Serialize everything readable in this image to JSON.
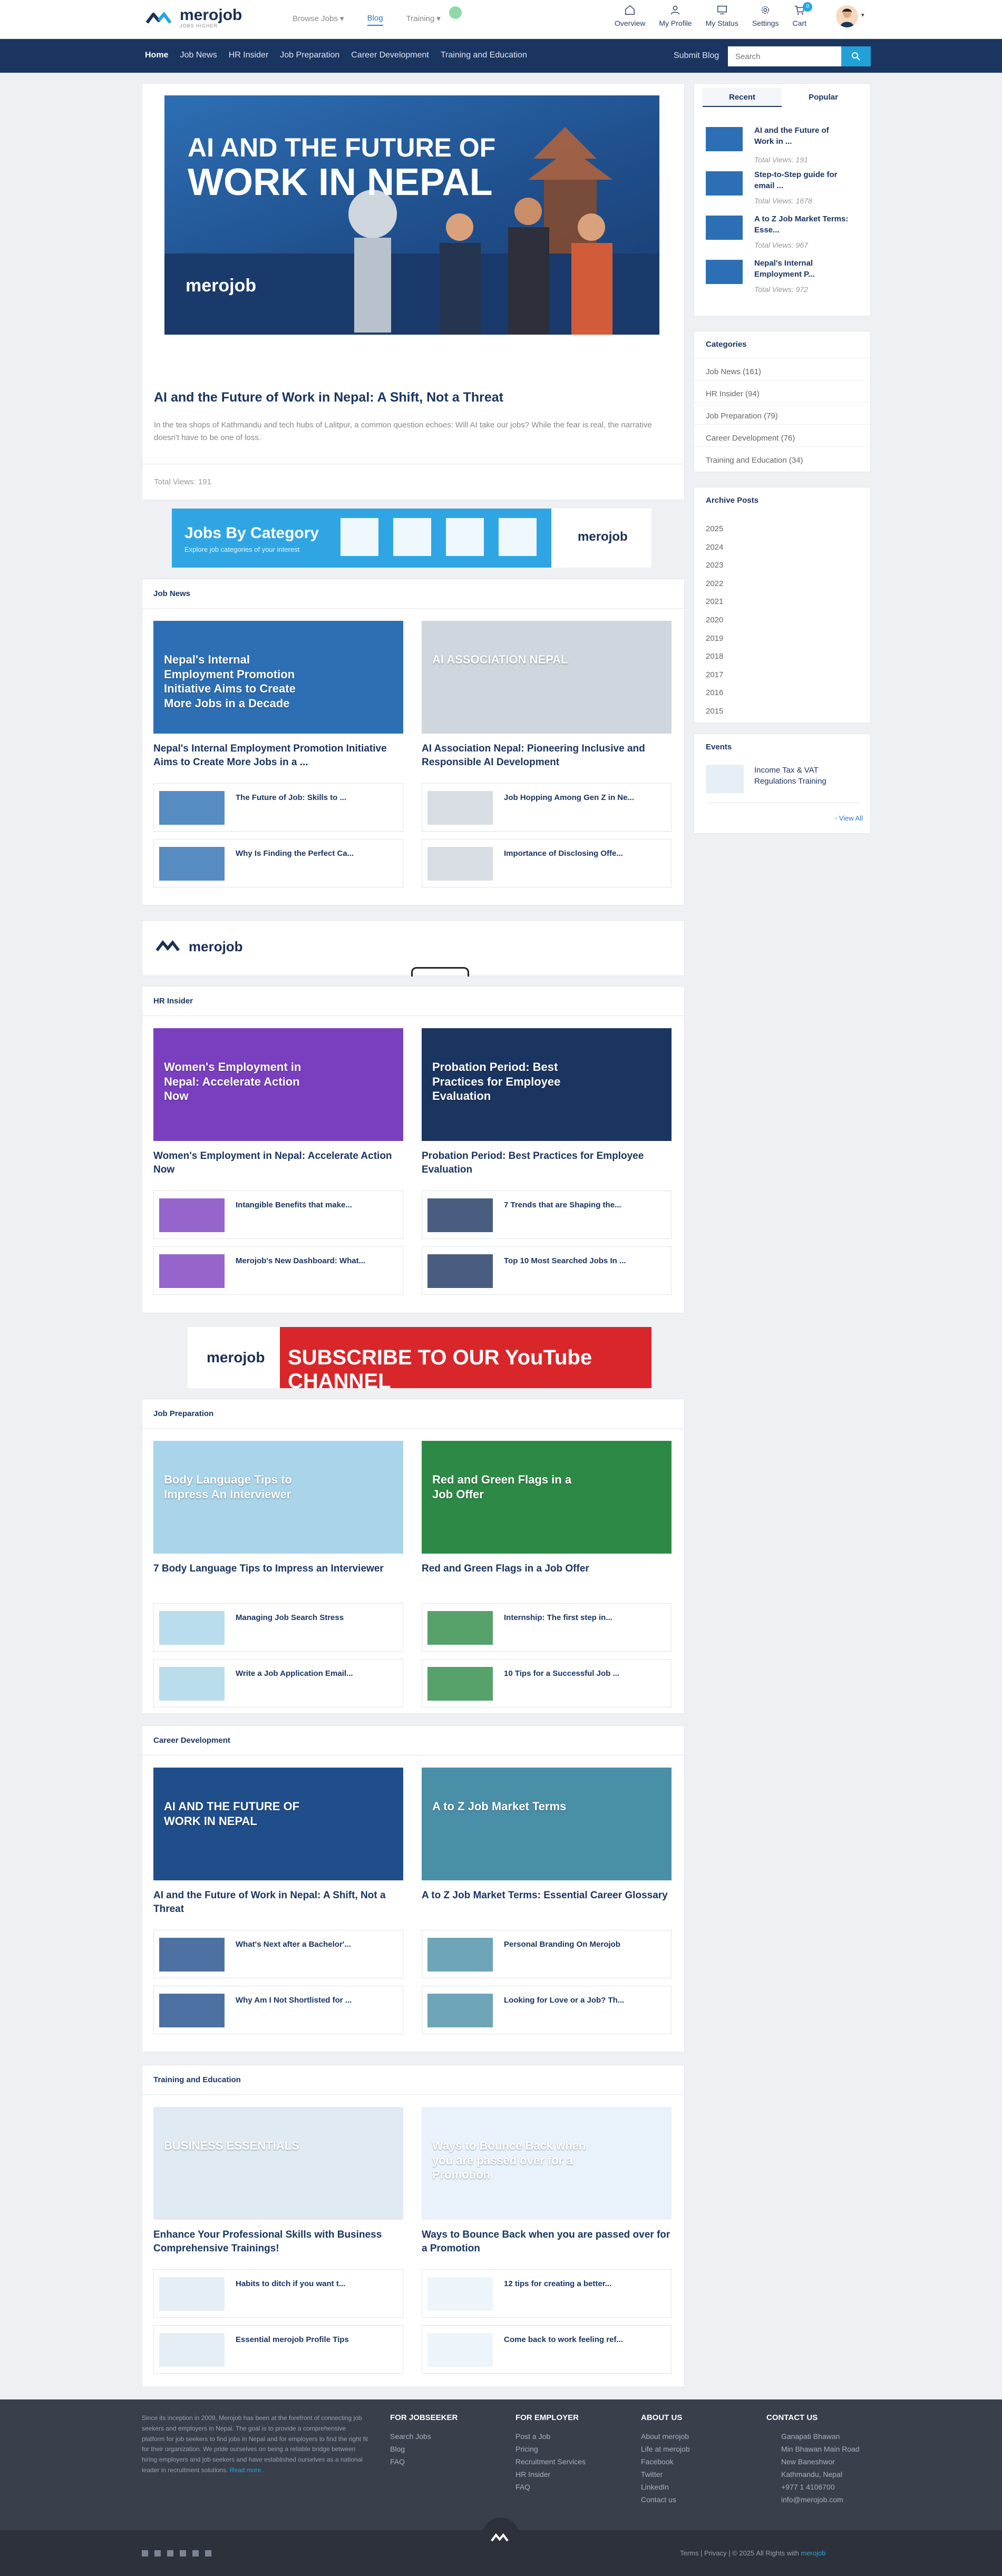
{
  "brand": {
    "name": "merojob",
    "tagline": "JOBS HIGHER"
  },
  "topnav": {
    "browse": "Browse Jobs",
    "blog": "Blog",
    "training": "Training"
  },
  "tools": [
    {
      "label": "Overview",
      "icon": "home-icon"
    },
    {
      "label": "My Profile",
      "icon": "user-icon"
    },
    {
      "label": "My Status",
      "icon": "monitor-icon"
    },
    {
      "label": "Settings",
      "icon": "gear-icon"
    },
    {
      "label": "Cart",
      "icon": "cart-icon",
      "badge": "0"
    }
  ],
  "navbar": {
    "links": [
      "Home",
      "Job News",
      "HR Insider",
      "Job Preparation",
      "Career Development",
      "Training and Education"
    ],
    "submit": "Submit Blog",
    "search_placeholder": "Search"
  },
  "hero": {
    "img_line1": "AI AND THE FUTURE OF",
    "img_line2": "WORK IN NEPAL",
    "img_brand": "merojob",
    "title": "AI and the Future of Work in Nepal: A Shift, Not a Threat",
    "desc": "In the tea shops of Kathmandu and tech hubs of Lalitpur, a common question echoes: Will AI take our jobs? While the fear is real, the narrative doesn't have to be one of loss.",
    "views": "Total Views: 191"
  },
  "banner": {
    "title": "Jobs By Category",
    "subtitle": "Explore job categories of your interest",
    "brand": "merojob"
  },
  "sections": [
    {
      "title": "Job News",
      "features": [
        {
          "title": "Nepal's Internal Employment Promotion Initiative Aims to Create More Jobs in a ...",
          "img": "Nepal's Internal Employment Promotion Initiative Aims to Create More Jobs in a Decade"
        },
        {
          "title": "AI Association Nepal: Pioneering Inclusive and Responsible AI Development",
          "img": "AI ASSOCIATION NEPAL"
        }
      ],
      "minis": [
        "The Future of Job: Skills to ...",
        "Job Hopping Among Gen Z in Ne...",
        "Why Is Finding the Perfect Ca...",
        "Importance of Disclosing Offe..."
      ]
    },
    {
      "title": "HR Insider",
      "features": [
        {
          "title": "Women's Employment in Nepal: Accelerate Action Now",
          "img": "Women's Employment in Nepal: Accelerate Action Now"
        },
        {
          "title": "Probation Period: Best Practices for Employee Evaluation",
          "img": "Probation Period: Best Practices for Employee Evaluation"
        }
      ],
      "minis": [
        "Intangible Benefits that make...",
        "7 Trends that are Shaping the...",
        "Merojob's New Dashboard: What...",
        "Top 10 Most Searched Jobs In ..."
      ]
    },
    {
      "title": "Job Preparation",
      "features": [
        {
          "title": "7 Body Language Tips to Impress an Interviewer",
          "img": "Body Language Tips to Impress An Interviewer"
        },
        {
          "title": "Red and Green Flags in a Job Offer",
          "img": "Red and Green Flags in a Job Offer"
        }
      ],
      "minis": [
        "Managing Job Search Stress",
        "Internship: The first step in...",
        "Write a Job Application Email...",
        "10 Tips for a Successful Job ..."
      ]
    },
    {
      "title": "Career Development",
      "features": [
        {
          "title": "AI and the Future of Work in Nepal: A Shift, Not a Threat",
          "img": "AI AND THE FUTURE OF WORK IN NEPAL"
        },
        {
          "title": "A to Z Job Market Terms: Essential Career Glossary",
          "img": "A to Z Job Market Terms"
        }
      ],
      "minis": [
        "What's Next after a Bachelor'...",
        "Personal Branding On Merojob",
        "Why Am I Not Shortlisted for ...",
        "Looking for Love or a Job? Th..."
      ]
    },
    {
      "title": "Training and Education",
      "features": [
        {
          "title": "Enhance Your Professional Skills with Business Comprehensive Trainings!",
          "img": "BUSINESS ESSENTIALS"
        },
        {
          "title": "Ways to Bounce Back when you are passed over for a Promotion",
          "img": "Ways to Bounce Back when you are passed over for a Promotion"
        }
      ],
      "minis": [
        "Habits to ditch if you want t...",
        "12 tips for creating a better...",
        "Essential merojob Profile Tips",
        "Come back to work feeling ref..."
      ]
    }
  ],
  "ads": {
    "mid_brand": "merojob",
    "yt": "SUBSCRIBE TO OUR YouTube CHANNEL"
  },
  "sidebar": {
    "tabs": [
      "Recent",
      "Popular"
    ],
    "recent": [
      {
        "title": "AI and the Future of Work in ...",
        "views": "Total Views: 191"
      },
      {
        "title": "Step-to-Step guide for email ...",
        "views": "Total Views: 1678"
      },
      {
        "title": "A to Z Job Market Terms: Esse...",
        "views": "Total Views: 967"
      },
      {
        "title": "Nepal's Internal Employment P...",
        "views": "Total Views: 972"
      }
    ],
    "categories_title": "Categories",
    "categories": [
      "Job News (161)",
      "HR Insider (94)",
      "Job Preparation (79)",
      "Career Development (76)",
      "Training and Education (34)"
    ],
    "archive_title": "Archive Posts",
    "archive": [
      "2025",
      "2024",
      "2023",
      "2022",
      "2021",
      "2020",
      "2019",
      "2018",
      "2017",
      "2016",
      "2015"
    ],
    "events_title": "Events",
    "event": "Income Tax & VAT Regulations Training",
    "view_all": "View All"
  },
  "footer": {
    "about": "Since its inception in 2009, Merojob has been at the forefront of connecting job seekers and employers in Nepal. The goal is to provide a comprehensive platform for job seekers to find jobs in Nepal and for employers to find the right fit for their organization. We pride ourselves on being a reliable bridge between hiring employers and job seekers and have established ourselves as a national leader in recruitment solutions.",
    "read_more": "Read more..",
    "jobseeker_h": "FOR JOBSEEKER",
    "jobseeker": [
      "Search Jobs",
      "Blog",
      "FAQ"
    ],
    "employer_h": "FOR EMPLOYER",
    "employer": [
      "Post a Job",
      "Pricing",
      "Recruitment Services",
      "HR Insider",
      "FAQ"
    ],
    "about_h": "ABOUT US",
    "about_links": [
      "About merojob",
      "Life at merojob",
      "Facebook",
      "Twitter",
      "LinkedIn",
      "Contact us"
    ],
    "contact_h": "CONTACT US",
    "contact": [
      "Ganapati Bhawan",
      "Min Bhawan Main Road",
      "New Baneshwor",
      "Kathmandu, Nepal",
      "+977 1 4106700",
      "info@merojob.com"
    ],
    "bottom": "Terms  | Privacy  | © 2025 All Rights with",
    "bottom_brand": "merojob"
  }
}
